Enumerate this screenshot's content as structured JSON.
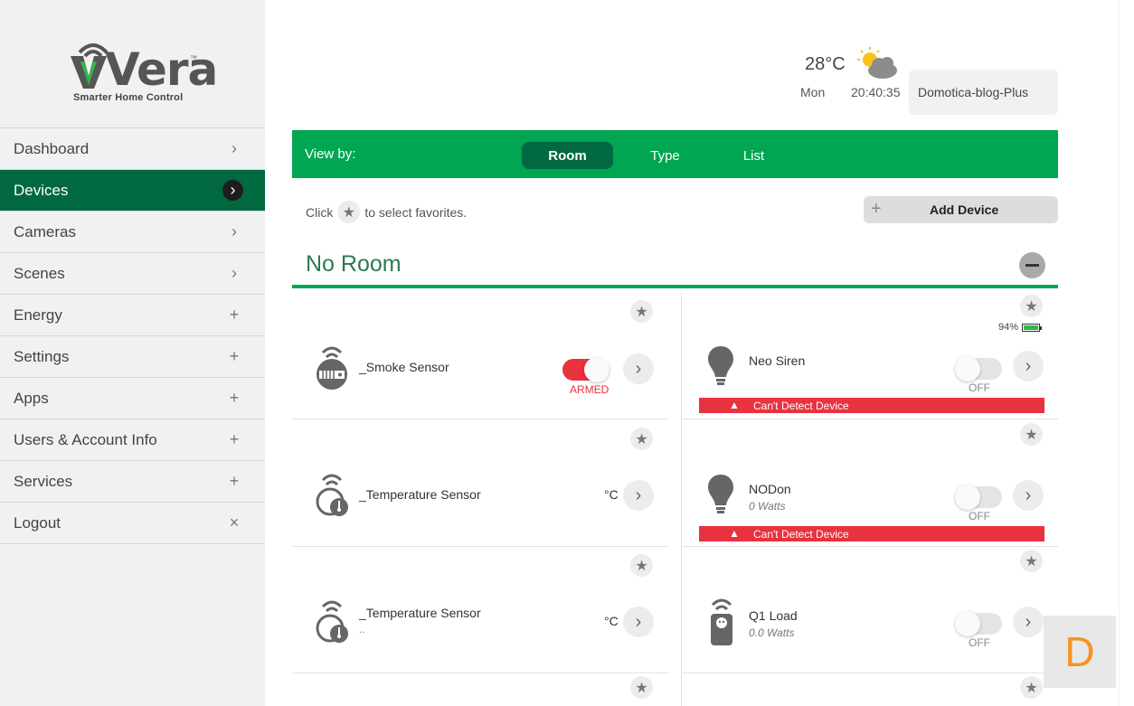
{
  "logo": {
    "word": "Vera",
    "tm": "™",
    "tagline": "Smarter Home Control"
  },
  "sidebar": {
    "items": [
      {
        "label": "Dashboard",
        "icon": "chevron-right-icon",
        "glyph": "›"
      },
      {
        "label": "Devices",
        "icon": "chevron-right-icon",
        "glyph": "›",
        "active": true
      },
      {
        "label": "Cameras",
        "icon": "chevron-right-icon",
        "glyph": "›"
      },
      {
        "label": "Scenes",
        "icon": "chevron-right-icon",
        "glyph": "›"
      },
      {
        "label": "Energy",
        "icon": "plus-icon",
        "glyph": "+"
      },
      {
        "label": "Settings",
        "icon": "plus-icon",
        "glyph": "+"
      },
      {
        "label": "Apps",
        "icon": "plus-icon",
        "glyph": "+"
      },
      {
        "label": "Users & Account Info",
        "icon": "plus-icon",
        "glyph": "+"
      },
      {
        "label": "Services",
        "icon": "plus-icon",
        "glyph": "+"
      },
      {
        "label": "Logout",
        "icon": "close-icon",
        "glyph": "×"
      }
    ]
  },
  "header": {
    "temperature": "28°C",
    "day": "Mon",
    "time": "20:40:35",
    "unit_name": "Domotica-blog-Plus"
  },
  "viewbar": {
    "label": "View by:",
    "tabs": [
      {
        "label": "Room",
        "active": true
      },
      {
        "label": "Type"
      },
      {
        "label": "List"
      }
    ]
  },
  "favorites_hint": {
    "before": "Click",
    "after": "to select favorites.",
    "star": "★"
  },
  "add_device": {
    "label": "Add Device",
    "plus": "+"
  },
  "room": {
    "title": "No Room"
  },
  "devices": {
    "smoke": {
      "name": "_Smoke Sensor",
      "status": "ARMED"
    },
    "temp1": {
      "name": "_Temperature Sensor",
      "unit": "°C"
    },
    "temp2": {
      "name": "_Temperature Sensor",
      "sub": "..",
      "unit": "°C"
    },
    "siren": {
      "name": "Neo Siren",
      "status": "OFF",
      "battery": "94%",
      "alert": "Can't Detect Device"
    },
    "nodon": {
      "name": "NODon",
      "sub": "0 Watts",
      "status": "OFF",
      "alert": "Can't Detect Device"
    },
    "q1": {
      "name": "Q1 Load",
      "sub": "0.0 Watts",
      "status": "OFF"
    }
  },
  "badge": {
    "letter": "D"
  },
  "colors": {
    "brand_green": "#00a651",
    "dark_green": "#006940",
    "alert_red": "#e8323e",
    "accent_orange": "#f7931e"
  }
}
